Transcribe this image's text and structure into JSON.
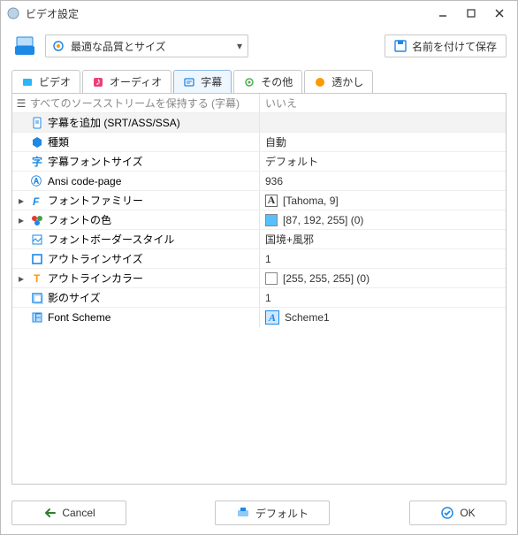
{
  "window": {
    "title": "ビデオ設定"
  },
  "toolbar": {
    "quality_label": "最適な品質とサイズ",
    "save_as_label": "名前を付けて保存"
  },
  "tabs": {
    "video": "ビデオ",
    "audio": "オーディオ",
    "subtitle": "字幕",
    "other": "その他",
    "watermark": "透かし"
  },
  "grid": {
    "header_l": "すべてのソースストリームを保持する (字幕)",
    "header_r": "いいえ",
    "add_subtitle": "字幕を追加 (SRT/ASS/SSA)",
    "rows": [
      {
        "label": "種類",
        "value": "自動"
      },
      {
        "label": "字幕フォントサイズ",
        "value": "デフォルト"
      },
      {
        "label": "Ansi code-page",
        "value": "936"
      },
      {
        "label": "フォントファミリー",
        "value": "[Tahoma, 9]",
        "expandable": true,
        "value_icon": "font"
      },
      {
        "label": "フォントの色",
        "value": "[87, 192, 255] (0)",
        "expandable": true,
        "value_icon": "color",
        "color": "#57c0ff"
      },
      {
        "label": "フォントボーダースタイル",
        "value": "国境+風邪"
      },
      {
        "label": "アウトラインサイズ",
        "value": "1"
      },
      {
        "label": "アウトラインカラー",
        "value": "[255, 255, 255] (0)",
        "expandable": true,
        "value_icon": "color",
        "color": "#ffffff"
      },
      {
        "label": "影のサイズ",
        "value": "1"
      },
      {
        "label": "Font Scheme",
        "value": "Scheme1",
        "value_icon": "scheme"
      }
    ]
  },
  "footer": {
    "cancel": "Cancel",
    "default": "デフォルト",
    "ok": "OK"
  }
}
